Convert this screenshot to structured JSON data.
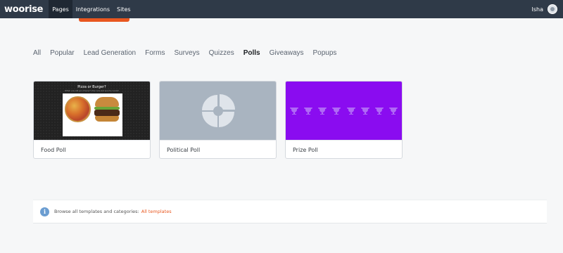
{
  "app": {
    "logo_text": "woorise",
    "nav": [
      {
        "label": "Pages",
        "active": true
      },
      {
        "label": "Integrations",
        "active": false
      },
      {
        "label": "Sites",
        "active": false
      }
    ],
    "user_name": "Isha"
  },
  "tabs": [
    {
      "label": "All",
      "active": false
    },
    {
      "label": "Popular",
      "active": false
    },
    {
      "label": "Lead Generation",
      "active": false
    },
    {
      "label": "Forms",
      "active": false
    },
    {
      "label": "Surveys",
      "active": false
    },
    {
      "label": "Quizzes",
      "active": false
    },
    {
      "label": "Polls",
      "active": true
    },
    {
      "label": "Giveaways",
      "active": false
    },
    {
      "label": "Popups",
      "active": false
    }
  ],
  "cards": [
    {
      "label": "Food Poll",
      "thumb_title": "Pizza or Burger?",
      "thumb_subtitle": "Which one will you choose? Vote now and see the results!",
      "thumb_icon": "pizza-burger-image"
    },
    {
      "label": "Political Poll",
      "thumb_icon": "pie-chart-icon"
    },
    {
      "label": "Prize Poll",
      "thumb_icon": "trophy-icon"
    }
  ],
  "info": {
    "text": "Browse all templates and categories:",
    "link": "All templates",
    "icon": "info-icon"
  },
  "colors": {
    "topbar": "#2f3a48",
    "accent": "#e8571f",
    "prize_bg": "#8a0cf0",
    "political_bg": "#a9b4c0",
    "info_icon": "#6b9dd1"
  }
}
